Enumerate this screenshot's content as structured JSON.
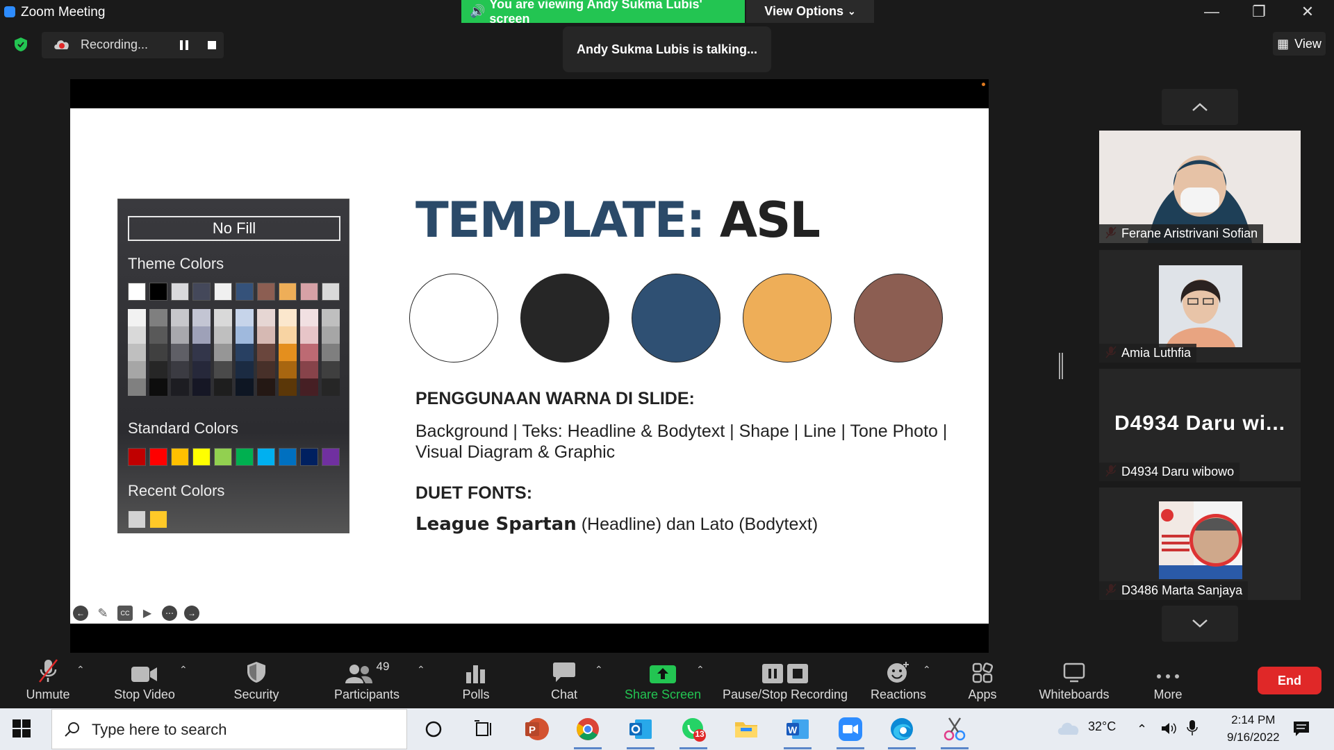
{
  "window": {
    "title": "Zoom Meeting",
    "viewing_banner": "You are viewing Andy Sukma Lubis' screen",
    "view_options": "View Options",
    "talking": "Andy Sukma Lubis is talking...",
    "view_button": "View"
  },
  "recording": {
    "label": "Recording..."
  },
  "slide": {
    "title_part1": "TEMPLATE:",
    "title_part2": "ASL",
    "palette": [
      "#ffffff",
      "#262626",
      "#2f5073",
      "#eeae58",
      "#8c5e52"
    ],
    "usage_heading": "PENGGUNAAN WARNA DI SLIDE:",
    "usage_body": "Background | Teks: Headline & Bodytext | Shape | Line | Tone Photo | Visual Diagram & Graphic",
    "fonts_heading": "DUET FONTS:",
    "fonts_headline_font": "League Spartan",
    "fonts_rest": " (Headline) dan Lato (Bodytext)"
  },
  "picker": {
    "no_fill": "No Fill",
    "theme_heading": "Theme Colors",
    "standard_heading": "Standard Colors",
    "recent_heading": "Recent Colors",
    "theme_colors": [
      "#ffffff",
      "#000000",
      "#d9d9dc",
      "#44485a",
      "#f0f0f0",
      "#35527a",
      "#8c5e52",
      "#eeae58",
      "#d6a1a6",
      "#d9d9d9"
    ],
    "theme_shades": [
      [
        "#f2f2f2",
        "#d9d9d9",
        "#bfbfbf",
        "#a6a6a6",
        "#808080"
      ],
      [
        "#7f7f7f",
        "#595959",
        "#404040",
        "#262626",
        "#0d0d0d"
      ],
      [
        "#c7c7cb",
        "#a8a8ad",
        "#5f5f66",
        "#3b3b42",
        "#1d1d22"
      ],
      [
        "#c3c5d3",
        "#9ea1b8",
        "#33364a",
        "#26283a",
        "#161725"
      ],
      [
        "#d9d9d9",
        "#bfbfbf",
        "#969696",
        "#4a4a4a",
        "#1e1e1e"
      ],
      [
        "#c6d4ea",
        "#9fb9dd",
        "#284062",
        "#1b2b42",
        "#0e1623"
      ],
      [
        "#e6d6d3",
        "#d6b9b3",
        "#6a463d",
        "#473029",
        "#241814"
      ],
      [
        "#fbe7cd",
        "#f8d4a3",
        "#e48f1e",
        "#a86610",
        "#5b3708"
      ],
      [
        "#f1e0e2",
        "#e7c5c8",
        "#bd6a73",
        "#87434a",
        "#461f24"
      ],
      [
        "#bfbfbf",
        "#a6a6a6",
        "#7f7f7f",
        "#3f3f3f",
        "#262626"
      ]
    ],
    "standard_colors": [
      "#c00000",
      "#ff0000",
      "#ffc000",
      "#ffff00",
      "#92d050",
      "#00b050",
      "#00b0f0",
      "#0070c0",
      "#002060",
      "#7030a0"
    ],
    "recent_colors": [
      "#d3d3d3",
      "#ffc928"
    ]
  },
  "participants": [
    {
      "name": "Ferane Aristrivani Sofian"
    },
    {
      "name": "Amia Luthfia"
    },
    {
      "name": "D4934 Daru wibowo",
      "big_label": "D4934  Daru  wi..."
    },
    {
      "name": "D3486 Marta Sanjaya"
    }
  ],
  "toolbar": {
    "unmute": "Unmute",
    "stop_video": "Stop Video",
    "security": "Security",
    "participants": "Participants",
    "participants_count": "49",
    "polls": "Polls",
    "chat": "Chat",
    "share_screen": "Share Screen",
    "pause_stop_recording": "Pause/Stop Recording",
    "reactions": "Reactions",
    "apps": "Apps",
    "whiteboards": "Whiteboards",
    "more": "More",
    "end": "End"
  },
  "taskbar": {
    "search_placeholder": "Type here to search",
    "whatsapp_badge": "13",
    "temperature": "32°C",
    "time": "2:14 PM",
    "date": "9/16/2022"
  },
  "colors": {
    "share_green": "#23c552",
    "end_red": "#e02828",
    "title_blue": "#2b4a69"
  }
}
